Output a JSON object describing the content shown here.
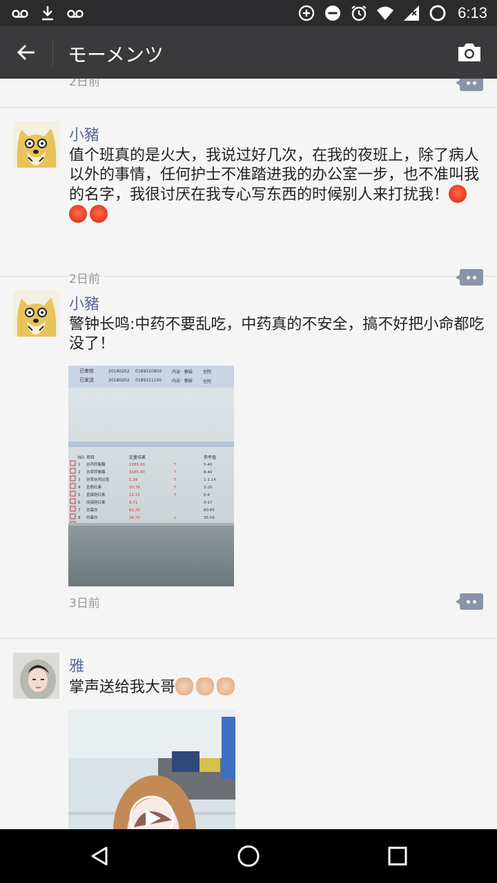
{
  "status_bar": {
    "time": "6:13",
    "left_icons": [
      "voicemail-icon",
      "download-icon",
      "voicemail-icon"
    ],
    "right_icons": [
      "data-saver-icon",
      "do-not-disturb-icon",
      "alarm-icon",
      "wifi-icon",
      "signal-icon",
      "battery-icon"
    ]
  },
  "app_bar": {
    "title": "モーメンツ",
    "back_icon": "arrow-back-icon",
    "camera_icon": "camera-icon"
  },
  "feed": {
    "partial_post": {
      "time": "2日前"
    },
    "posts": [
      {
        "author": "小豬",
        "text": "值个班真的是火大，我说过好几次，在我的夜班上，除了病人以外的事情，任何护士不准踏进我的办公室一步，也不准叫我的名字，我很讨厌在我专心写东西的时候别人来打扰我！",
        "emoji": [
          "angry-face",
          "angry-face",
          "angry-face"
        ],
        "time": "2日前"
      },
      {
        "author": "小豬",
        "text": "警钟长鸣:中药不要乱吃，中药真的不安全，搞不好把小命都吃没了！",
        "time": "3日前",
        "photo_table": {
          "top_rows": [
            {
              "status": "已审核",
              "date": "20180202",
              "id": "0189310800",
              "dept": "内泌 · 蓉娟",
              "loc": "住院"
            },
            {
              "status": "已发送",
              "date": "20180202",
              "id": "0189311100",
              "dept": "内泌 · 蓉娟",
              "loc": "住院"
            }
          ],
          "headers": [
            "NO",
            "项目",
            "定量结果",
            "",
            "参考值"
          ],
          "rows": [
            [
              "1",
              "谷丙转氨酶",
              "2285.00",
              "↑",
              "5-40"
            ],
            [
              "2",
              "谷草转氨酶",
              "3185.00",
              "↑",
              "8-40"
            ],
            [
              "3",
              "谷草谷丙比值",
              "1.39",
              "↑",
              "1-1.14"
            ],
            [
              "4",
              "总胆红素",
              "20.76",
              "↑",
              "2-20"
            ],
            [
              "5",
              "直接胆红素",
              "11.15",
              "↑",
              "0-6"
            ],
            [
              "6",
              "间接胆红素",
              "9.71",
              "",
              "0-17"
            ],
            [
              "7",
              "总蛋白",
              "61.20",
              "",
              "60-85"
            ],
            [
              "8",
              "白蛋白",
              "34.70",
              "↓",
              "35-55"
            ],
            [
              "9",
              "球蛋白",
              "26.50",
              "",
              "20-30"
            ]
          ]
        }
      },
      {
        "author": "雅",
        "text": "掌声送给我大哥",
        "emoji": [
          "clapping-hands",
          "clapping-hands",
          "clapping-hands"
        ],
        "video_icon": "play-icon"
      }
    ]
  },
  "nav_bar": {
    "icons": [
      "back-triangle-icon",
      "home-circle-icon",
      "recents-square-icon"
    ]
  },
  "colors": {
    "status_bar_bg": "#2b2b2d",
    "app_bar_bg": "#3a3a3c",
    "author_name": "#5b6b93",
    "feed_bg": "#f5f5f5",
    "comment_button": "#8a94a8"
  }
}
